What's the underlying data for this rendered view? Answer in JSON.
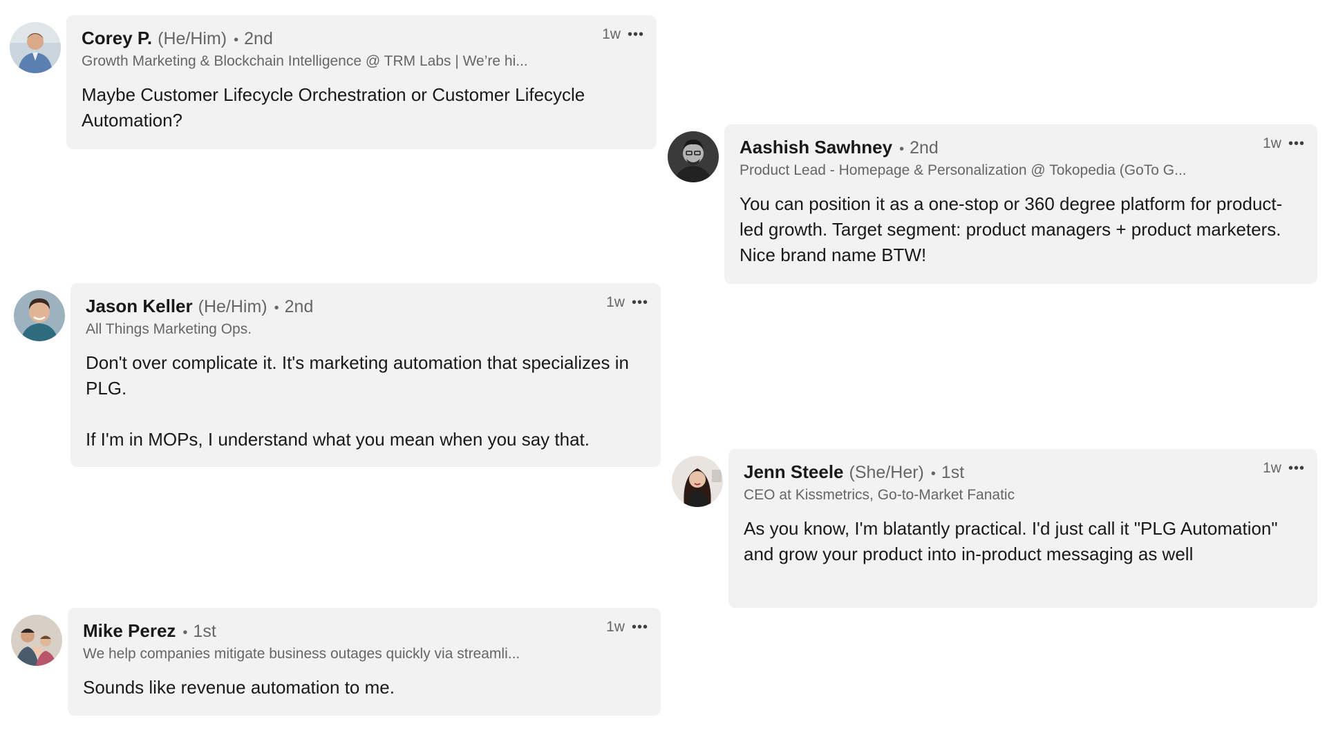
{
  "comments": [
    {
      "author": "Corey P.",
      "pronouns": "(He/Him)",
      "separator": "•",
      "degree": "2nd",
      "headline": "Growth Marketing & Blockchain Intelligence @ TRM Labs | We’re hi...",
      "time": "1w",
      "more": "•••",
      "paragraphs": [
        "Maybe Customer Lifecycle Orchestration or Customer Lifecycle Automation?"
      ]
    },
    {
      "author": "Aashish Sawhney",
      "pronouns": "",
      "separator": "•",
      "degree": "2nd",
      "headline": "Product Lead - Homepage & Personalization @ Tokopedia (GoTo G...",
      "time": "1w",
      "more": "•••",
      "paragraphs": [
        "You can position it as a one-stop or 360 degree platform for product-led growth. Target segment: product managers + product marketers. Nice brand name BTW!"
      ]
    },
    {
      "author": "Jason Keller",
      "pronouns": "(He/Him)",
      "separator": "•",
      "degree": "2nd",
      "headline": "All Things Marketing Ops.",
      "time": "1w",
      "more": "•••",
      "paragraphs": [
        "Don't over complicate it. It's marketing automation that specializes in PLG.",
        "If I'm in MOPs, I understand what you mean when you say that."
      ]
    },
    {
      "author": "Jenn Steele",
      "pronouns": "(She/Her)",
      "separator": "•",
      "degree": "1st",
      "headline": "CEO at Kissmetrics, Go-to-Market Fanatic",
      "time": "1w",
      "more": "•••",
      "paragraphs": [
        "As you know, I'm blatantly practical. I'd just call it \"PLG Automation\" and grow your product into in-product messaging as well"
      ]
    },
    {
      "author": "Mike Perez",
      "pronouns": "",
      "separator": "•",
      "degree": "1st",
      "headline": "We help companies mitigate business outages quickly via streamli...",
      "time": "1w",
      "more": "•••",
      "paragraphs": [
        "Sounds like revenue automation to me."
      ]
    }
  ],
  "colors": {
    "bubble": "#f2f2f2",
    "text": "#191919",
    "muted": "#666666"
  }
}
